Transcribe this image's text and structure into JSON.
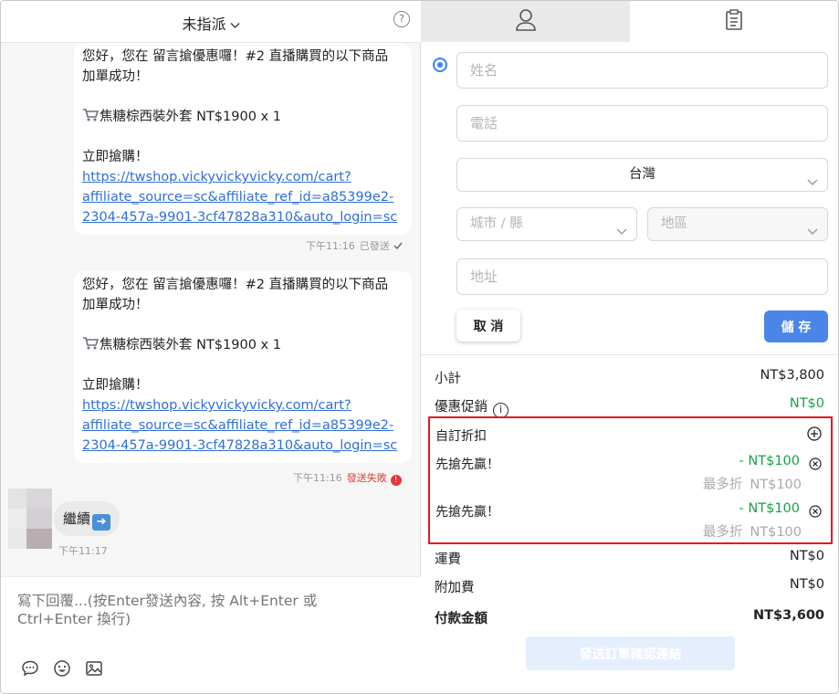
{
  "chat": {
    "header_title": "未指派",
    "messages": [
      {
        "lines": [
          "您好，您在 留言搶優惠囉！#2 直播購買的以下商品",
          "加單成功！"
        ],
        "item": "焦糖棕西裝外套 NT$1900 x 1",
        "cta": "立即搶購！",
        "link_lines": [
          "https://twshop.vickyvickyvicky.com/cart?",
          "affiliate_source=sc&affiliate_ref_id=a85399e2-",
          "2304-457a-9901-3cf47828a310&auto_login=sc"
        ],
        "time": "下午11:16",
        "status": "已發送"
      },
      {
        "lines": [
          "您好，您在 留言搶優惠囉！#2 直播購買的以下商品",
          "加單成功！"
        ],
        "item": "焦糖棕西裝外套 NT$1900 x 1",
        "cta": "立即搶購！",
        "link_lines": [
          "https://twshop.vickyvickyvicky.com/cart?",
          "affiliate_source=sc&affiliate_ref_id=a85399e2-",
          "2304-457a-9901-3cf47828a310&auto_login=sc"
        ],
        "time": "下午11:16",
        "status": "發送失敗"
      }
    ],
    "customer_message": "繼續",
    "customer_time": "下午11:17",
    "composer_placeholder": "寫下回覆...(按Enter發送內容, 按 Alt+Enter 或 Ctrl+Enter 換行)"
  },
  "form": {
    "name_placeholder": "姓名",
    "phone_placeholder": "電話",
    "country_value": "台灣",
    "city_placeholder": "城市 / 縣",
    "district_placeholder": "地區",
    "address_placeholder": "地址",
    "cancel_label": "取 消",
    "save_label": "儲 存"
  },
  "summary": {
    "subtotal_label": "小計",
    "subtotal_value": "NT$3,800",
    "promo_label": "優惠促銷",
    "promo_value": "NT$0",
    "custom_discount_label": "自訂折扣",
    "discounts": [
      {
        "name": "先搶先贏！",
        "amount": "- NT$100",
        "max_label": "最多折",
        "max_value": "NT$100"
      },
      {
        "name": "先搶先贏！",
        "amount": "- NT$100",
        "max_label": "最多折",
        "max_value": "NT$100"
      }
    ],
    "shipping_label": "運費",
    "shipping_value": "NT$0",
    "extra_fee_label": "附加費",
    "extra_fee_value": "NT$0",
    "total_label": "付款金額",
    "total_value": "NT$3,600",
    "send_button_label": "發送訂單確認連結"
  },
  "colors": {
    "accent": "#4a86e8",
    "link": "#2f6fd8",
    "error": "#e53935",
    "green": "#16a34a",
    "highlight_border": "#e31b1b"
  }
}
